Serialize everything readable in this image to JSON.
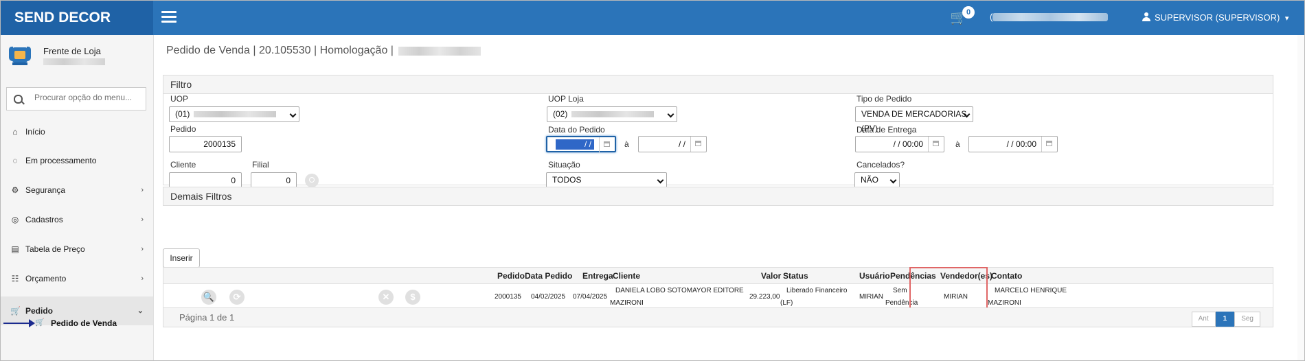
{
  "app": {
    "brand": "SEND DECOR"
  },
  "topbar": {
    "cart_count": "0",
    "paren_open": "(",
    "user_label": "SUPERVISOR (SUPERVISOR)",
    "user_caret": "▾"
  },
  "sidebar": {
    "store_name": "Frente de Loja",
    "search_placeholder": "Procurar opção do menu...",
    "items": [
      {
        "label": "Início",
        "icon": "home-icon",
        "glyph": "⌂",
        "chevron": ""
      },
      {
        "label": "Em processamento",
        "icon": "spinner-icon",
        "glyph": "◌",
        "chevron": ""
      },
      {
        "label": "Segurança",
        "icon": "gears-icon",
        "glyph": "⚙",
        "chevron": "›"
      },
      {
        "label": "Cadastros",
        "icon": "target-icon",
        "glyph": "◎",
        "chevron": "›"
      },
      {
        "label": "Tabela de Preço",
        "icon": "table-icon",
        "glyph": "▤",
        "chevron": "›"
      },
      {
        "label": "Orçamento",
        "icon": "sliders-icon",
        "glyph": "☷",
        "chevron": "›"
      },
      {
        "label": "Pedido",
        "icon": "cart-icon",
        "glyph": "🛒",
        "chevron": "⌄"
      }
    ],
    "sub_item": {
      "label": "Pedido de Venda",
      "glyph": "🛒"
    }
  },
  "main": {
    "page_title": "Pedido de Venda | 20.105530 | Homologação |",
    "filter_title": "Filtro",
    "other_filters_title": "Demais Filtros",
    "insert_label": "Inserir"
  },
  "filters": {
    "uop_label": "UOP",
    "uop_value": "(01)",
    "uop_loja_label": "UOP Loja",
    "uop_loja_value": "(02)",
    "tipo_label": "Tipo de Pedido",
    "tipo_value": "VENDA DE MERCADORIAS (PV)",
    "pedido_label": "Pedido",
    "pedido_value": "2000135",
    "data_pedido_label": "Data do Pedido",
    "data_pedido_from": "/ /",
    "data_pedido_to": "/ /",
    "a_sep": "à",
    "data_entrega_label": "Data de Entrega",
    "data_entrega_from": "/ /   00:00",
    "data_entrega_to": "/ /   00:00",
    "cliente_label": "Cliente",
    "cliente_value": "0",
    "filial_label": "Filial",
    "filial_value": "0",
    "situacao_label": "Situação",
    "situacao_value": "TODOS",
    "cancelados_label": "Cancelados?",
    "cancelados_value": "NÃO"
  },
  "table": {
    "headers": {
      "pedido": "Pedido",
      "data_pedido": "Data Pedido",
      "entrega": "Entrega",
      "cliente": "Cliente",
      "valor": "Valor",
      "status": "Status",
      "usuario": "Usuário",
      "pendencias": "Pendências",
      "vendedores": "Vendedor(es)",
      "contato": "Contato"
    },
    "row": {
      "pedido": "2000135",
      "data_pedido": "04/02/2025",
      "entrega": "07/04/2025",
      "cliente_l1": "DANIELA LOBO SOTOMAYOR EDITORE",
      "cliente_l2": "MAZIRONI",
      "valor": "29.223,00",
      "status_l1": "Liberado Financeiro",
      "status_l2": "(LF)",
      "usuario": "MIRIAN",
      "pend_l1": "Sem",
      "pend_l2": "Pendência",
      "vendedor": "MIRIAN",
      "contato_l1": "MARCELO HENRIQUE",
      "contato_l2": "MAZIRONI"
    },
    "row_icons": {
      "view": "🔍",
      "history": "⟳",
      "cancel": "✕",
      "money": "$"
    },
    "page_info": "Página 1 de 1",
    "pager": {
      "prev": "Ant",
      "current": "1",
      "next": "Seg"
    }
  }
}
